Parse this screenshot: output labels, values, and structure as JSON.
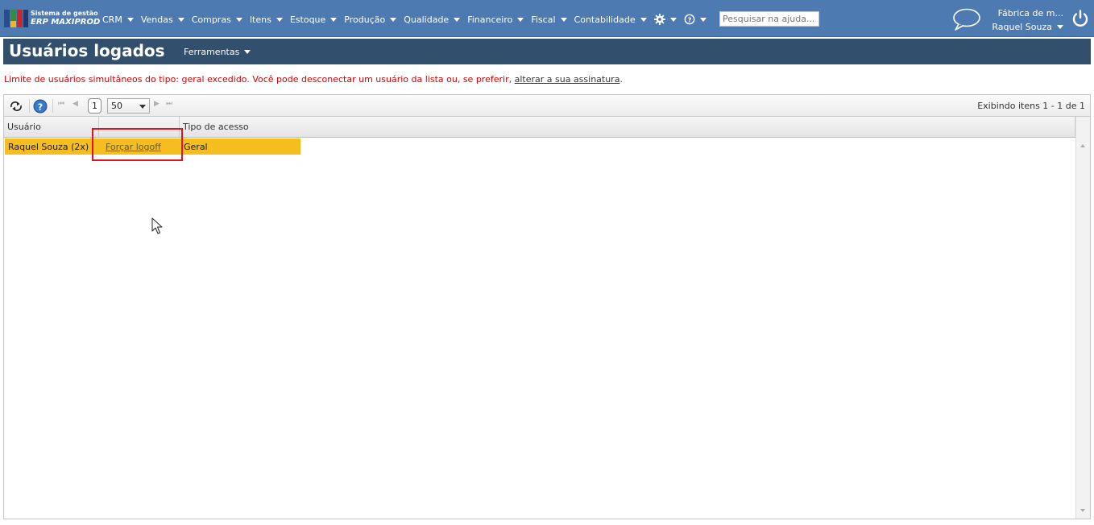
{
  "app": {
    "brand_line1": "Sistema de gestão",
    "brand_line2": "ERP MAXIPROD"
  },
  "nav": {
    "items": [
      {
        "label": "CRM"
      },
      {
        "label": "Vendas"
      },
      {
        "label": "Compras"
      },
      {
        "label": "Itens"
      },
      {
        "label": "Estoque"
      },
      {
        "label": "Produção"
      },
      {
        "label": "Qualidade"
      },
      {
        "label": "Financeiro"
      },
      {
        "label": "Fiscal"
      },
      {
        "label": "Contabilidade"
      }
    ],
    "settings_icon": "gear-icon",
    "help_icon": "question-circle-icon",
    "search_placeholder": "Pesquisar na ajuda..."
  },
  "account": {
    "company": "Fábrica de m...",
    "user": "Raquel Souza"
  },
  "page": {
    "title": "Usuários logados",
    "tools_menu": "Ferramentas"
  },
  "warning": {
    "text": "Limite de usuários simultâneos do tipo: geral excedido. Você pode desconectar um usuário da lista ou, se preferir, ",
    "link": "alterar a sua assinatura",
    "end": "."
  },
  "grid": {
    "page": "1",
    "page_size": "50",
    "items_info": "Exibindo itens 1 - 1 de 1",
    "columns": [
      "Usuário",
      "",
      "Tipo de acesso"
    ],
    "rows": [
      {
        "user": "Raquel Souza (2x)",
        "action": "Forçar logoff",
        "access_type": "Geral"
      }
    ]
  },
  "colors": {
    "topbar": "#4d7ab0",
    "titlebar": "#334f6e",
    "selected_row": "#f5bd1e",
    "warning_text": "#d40000",
    "highlight_border": "#e0141e"
  }
}
